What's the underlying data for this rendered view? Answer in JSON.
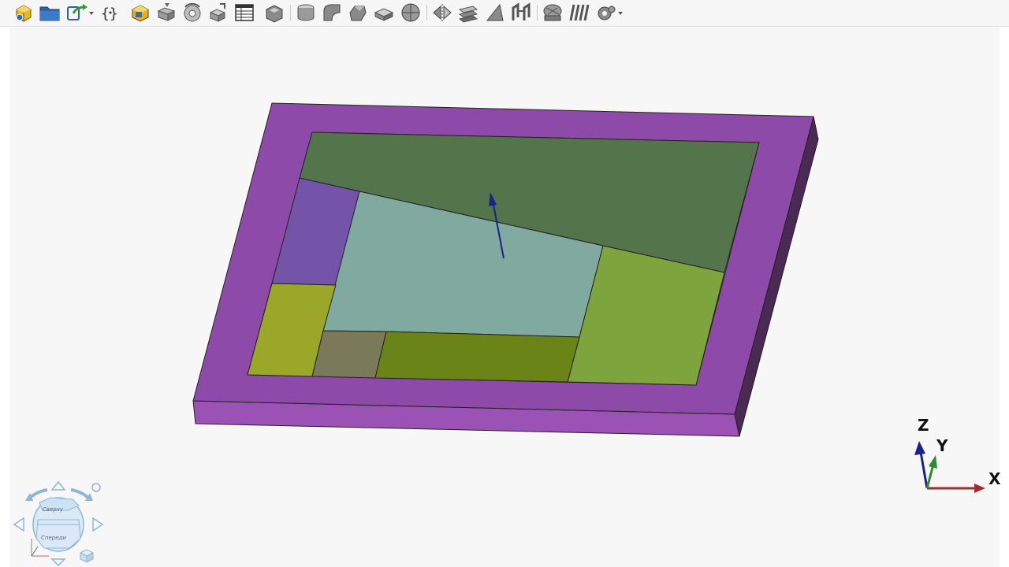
{
  "toolbar": {
    "items": [
      {
        "id": "new-part",
        "icon": "new-part-icon"
      },
      {
        "id": "open",
        "icon": "folder-icon"
      },
      {
        "id": "export",
        "icon": "export-icon",
        "has_dropdown": true
      },
      {
        "id": "variables",
        "icon": "variables-icon",
        "glyph": "{}"
      },
      {
        "id": "body",
        "icon": "body-cube-icon"
      },
      {
        "id": "extrude",
        "icon": "extrude-icon"
      },
      {
        "id": "revolve",
        "icon": "revolve-icon"
      },
      {
        "id": "sweep",
        "icon": "sweep-icon"
      },
      {
        "id": "table",
        "icon": "table-icon"
      },
      {
        "id": "shell",
        "icon": "shell-icon"
      },
      {
        "id": "cylinder",
        "icon": "cylinder-icon"
      },
      {
        "id": "fillet",
        "icon": "fillet-icon"
      },
      {
        "id": "chamfer",
        "icon": "chamfer-icon"
      },
      {
        "id": "boolean",
        "icon": "boolean-icon"
      },
      {
        "id": "sphere",
        "icon": "sphere-icon"
      },
      {
        "id": "mirror",
        "icon": "mirror-icon"
      },
      {
        "id": "section",
        "icon": "section-icon"
      },
      {
        "id": "draft",
        "icon": "draft-icon"
      },
      {
        "id": "measure",
        "icon": "measure-icon"
      },
      {
        "id": "mesh",
        "icon": "mesh-icon"
      },
      {
        "id": "pattern",
        "icon": "pattern-icon"
      },
      {
        "id": "settings",
        "icon": "gear-icon",
        "has_dropdown": true
      }
    ]
  },
  "triad": {
    "x_label": "X",
    "y_label": "Y",
    "z_label": "Z",
    "x_color": "#a52a2a",
    "y_color": "#2e8b2e",
    "z_color": "#1b1f8f"
  },
  "viewcube": {
    "top_label": "Сверху",
    "front_label": "Спереди"
  },
  "model": {
    "frame_color": "#8e4aa8",
    "faces": [
      {
        "name": "dark-green-face",
        "color": "#54744b"
      },
      {
        "name": "purple-face",
        "color": "#7454a8"
      },
      {
        "name": "teal-face",
        "color": "#80aaa0"
      },
      {
        "name": "light-green-face",
        "color": "#7ea43e"
      },
      {
        "name": "olive-face",
        "color": "#9aa728"
      },
      {
        "name": "gray-brown-face",
        "color": "#7a7a5a"
      },
      {
        "name": "dark-olive-face",
        "color": "#6b8418"
      }
    ],
    "arrow_color": "#1b1f8f"
  }
}
